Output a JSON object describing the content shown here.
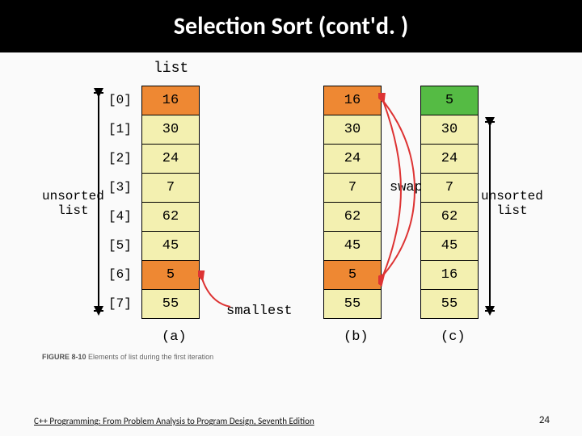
{
  "title": "Selection Sort (cont'd. )",
  "list_label": "list",
  "unsorted_label_line1": "unsorted",
  "unsorted_label_line2": "list",
  "swap_label": "swap",
  "smallest_label": "smallest",
  "indices": [
    "[0]",
    "[1]",
    "[2]",
    "[3]",
    "[4]",
    "[5]",
    "[6]",
    "[7]"
  ],
  "columns": {
    "a": {
      "label": "(a)",
      "values": [
        "16",
        "30",
        "24",
        "7",
        "62",
        "45",
        "5",
        "55"
      ],
      "highlight": {
        "0": "orange",
        "6": "orange"
      }
    },
    "b": {
      "label": "(b)",
      "values": [
        "16",
        "30",
        "24",
        "7",
        "62",
        "45",
        "5",
        "55"
      ],
      "highlight": {
        "0": "orange",
        "6": "orange"
      }
    },
    "c": {
      "label": "(c)",
      "values": [
        "5",
        "30",
        "24",
        "7",
        "62",
        "45",
        "16",
        "55"
      ],
      "highlight": {
        "0": "green"
      }
    }
  },
  "figure_caption_prefix": "FIGURE 8-10",
  "figure_caption_text": " Elements of list during the first iteration",
  "footer": "C++ Programming: From Problem Analysis to Program Design, Seventh Edition",
  "page_number": "24"
}
